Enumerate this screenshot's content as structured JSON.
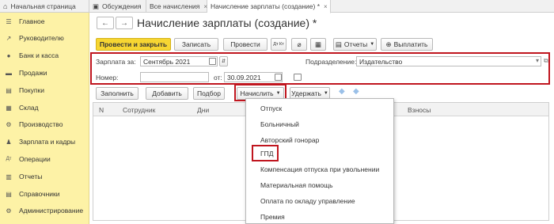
{
  "tabs": [
    {
      "label": "Начальная страница"
    },
    {
      "label": "Обсуждения"
    },
    {
      "label": "Все начисления"
    },
    {
      "label": "Начисление зарплаты (создание) *"
    }
  ],
  "sidebar": {
    "items": [
      {
        "label": "Главное",
        "icon": "menu-icon"
      },
      {
        "label": "Руководителю",
        "icon": "chart-line-icon"
      },
      {
        "label": "Банк и касса",
        "icon": "coins-icon"
      },
      {
        "label": "Продажи",
        "icon": "cart-icon"
      },
      {
        "label": "Покупки",
        "icon": "basket-icon"
      },
      {
        "label": "Склад",
        "icon": "warehouse-icon"
      },
      {
        "label": "Производство",
        "icon": "factory-icon"
      },
      {
        "label": "Зарплата и кадры",
        "icon": "people-icon"
      },
      {
        "label": "Операции",
        "icon": "operations-icon"
      },
      {
        "label": "Отчеты",
        "icon": "report-icon"
      },
      {
        "label": "Справочники",
        "icon": "book-icon"
      },
      {
        "label": "Администрирование",
        "icon": "gear-icon"
      }
    ]
  },
  "doc": {
    "title": "Начисление зарплаты (создание) *"
  },
  "toolbar": {
    "post_close": "Провести и закрыть",
    "save": "Записать",
    "post": "Провести",
    "dt_kt": "Дт Кт",
    "reports": "Отчеты",
    "pay": "Выплатить"
  },
  "form": {
    "salary_for_label": "Зарплата за:",
    "salary_for_value": "Сентябрь 2021",
    "department_label": "Подразделение:",
    "department_value": "Издательство",
    "number_label": "Номер:",
    "number_value": "",
    "from_label": "от:",
    "date_value": "30.09.2021"
  },
  "table_toolbar": {
    "fill": "Заполнить",
    "add": "Добавить",
    "select": "Подбор",
    "accrue": "Начислить",
    "withhold": "Удержать"
  },
  "table": {
    "columns": [
      "N",
      "Сотрудник",
      "Дни",
      "Взносы"
    ]
  },
  "menu": {
    "items": [
      "Отпуск",
      "Больничный",
      "Авторский гонорар",
      "ГПД",
      "Компенсация отпуска при увольнении",
      "Материальная помощь",
      "Оплата по окладу управление",
      "Премия"
    ]
  },
  "colors": {
    "accent_yellow": "#f7d632",
    "sidebar_bg": "#fdf2a6",
    "highlight_red": "#c0161f"
  }
}
